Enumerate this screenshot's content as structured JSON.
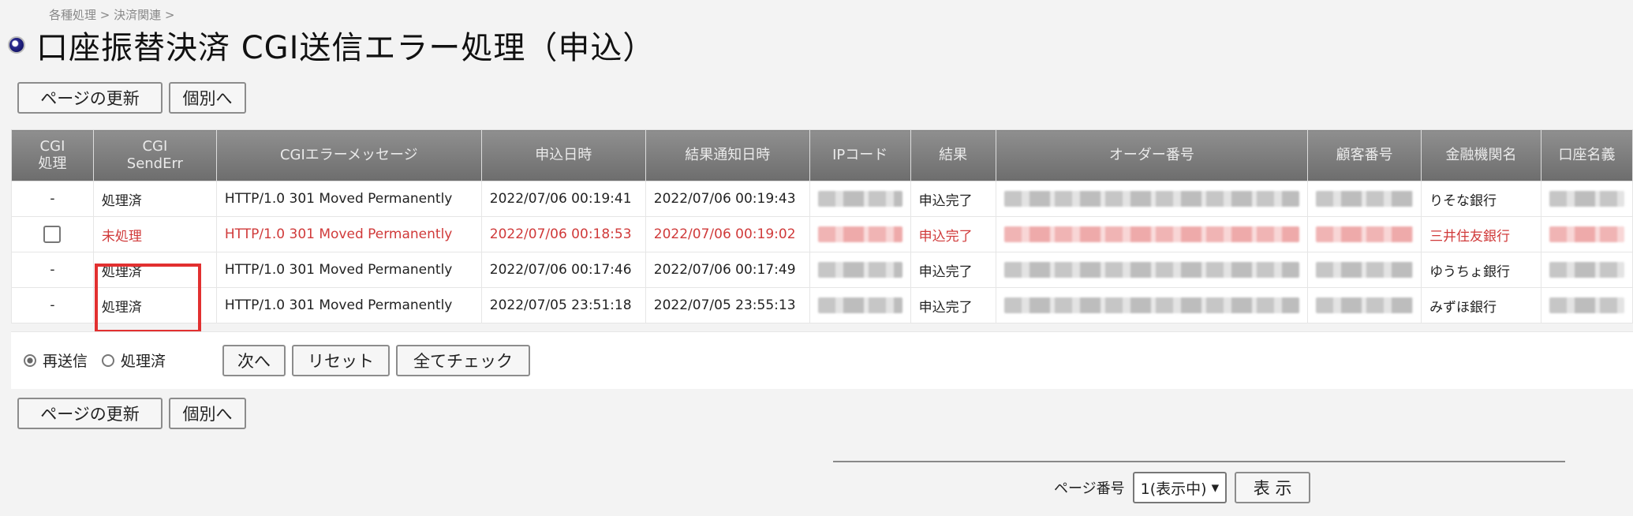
{
  "breadcrumb": "各種処理 > 決済関連 >",
  "title": "口座振替決済 CGI送信エラー処理（申込）",
  "buttons": {
    "refresh": "ページの更新",
    "individual": "個別へ",
    "next": "次へ",
    "reset": "リセット",
    "check_all": "全てチェック",
    "show": "表 示"
  },
  "table": {
    "headers": [
      "CGI\n処理",
      "CGI\nSendErr",
      "CGIエラーメッセージ",
      "申込日時",
      "結果通知日時",
      "IPコード",
      "結果",
      "オーダー番号",
      "顧客番号",
      "金融機関名",
      "口座名義"
    ],
    "rows": [
      {
        "proc": "-",
        "status": "処理済",
        "message": "HTTP/1.0 301 Moved Permanently",
        "applied": "2022/07/06 00:19:41",
        "notified": "2022/07/06 00:19:43",
        "result": "申込完了",
        "bank": "りそな銀行",
        "error": false
      },
      {
        "proc": "",
        "status": "未処理",
        "message": "HTTP/1.0 301 Moved Permanently",
        "applied": "2022/07/06 00:18:53",
        "notified": "2022/07/06 00:19:02",
        "result": "申込完了",
        "bank": "三井住友銀行",
        "error": true
      },
      {
        "proc": "-",
        "status": "処理済",
        "message": "HTTP/1.0 301 Moved Permanently",
        "applied": "2022/07/06 00:17:46",
        "notified": "2022/07/06 00:17:49",
        "result": "申込完了",
        "bank": "ゆうちょ銀行",
        "error": false
      },
      {
        "proc": "-",
        "status": "処理済",
        "message": "HTTP/1.0 301 Moved Permanently",
        "applied": "2022/07/05 23:51:18",
        "notified": "2022/07/05 23:55:13",
        "result": "申込完了",
        "bank": "みずほ銀行",
        "error": false
      }
    ]
  },
  "radio": {
    "resend": "再送信",
    "processed": "処理済",
    "selected": "resend"
  },
  "pager": {
    "label": "ページ番号",
    "selected": "1(表示中)"
  },
  "colors": {
    "error_text": "#d03a3a",
    "highlight": "#e23030",
    "header_bg": "#7a7a7a"
  }
}
